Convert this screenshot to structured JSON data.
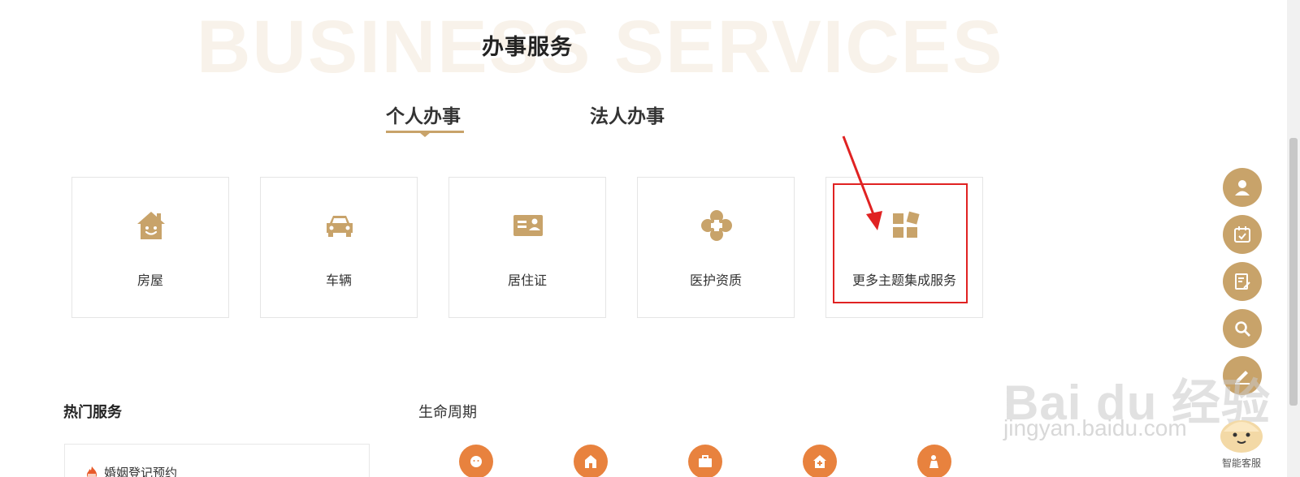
{
  "header": {
    "bg_word": "BUSINESS SERVICES",
    "title": "办事服务"
  },
  "tabs": [
    {
      "label": "个人办事",
      "active": true
    },
    {
      "label": "法人办事",
      "active": false
    }
  ],
  "cards": [
    {
      "label": "房屋",
      "icon": "house-icon"
    },
    {
      "label": "车辆",
      "icon": "car-icon"
    },
    {
      "label": "居住证",
      "icon": "id-card-icon"
    },
    {
      "label": "医护资质",
      "icon": "medical-cross-icon"
    },
    {
      "label": "更多主题集成服务",
      "icon": "apps-grid-icon"
    }
  ],
  "hot_services": {
    "title": "热门服务",
    "items": [
      {
        "label": "婚姻登记预约",
        "icon": "flame-icon"
      }
    ]
  },
  "life_cycle": {
    "title": "生命周期",
    "icons": [
      "baby-icon",
      "school-icon",
      "briefcase-icon",
      "home-care-icon",
      "elder-icon"
    ]
  },
  "float_buttons": [
    "user-icon",
    "calendar-check-icon",
    "edit-doc-icon",
    "search-icon",
    "pen-icon"
  ],
  "assistant": {
    "label": "智能客服"
  },
  "watermark": {
    "main": "Bai du 经验",
    "sub": "jingyan.baidu.com"
  },
  "colors": {
    "accent": "#c8a36a",
    "life": "#e8823e",
    "highlight": "#e02222"
  }
}
